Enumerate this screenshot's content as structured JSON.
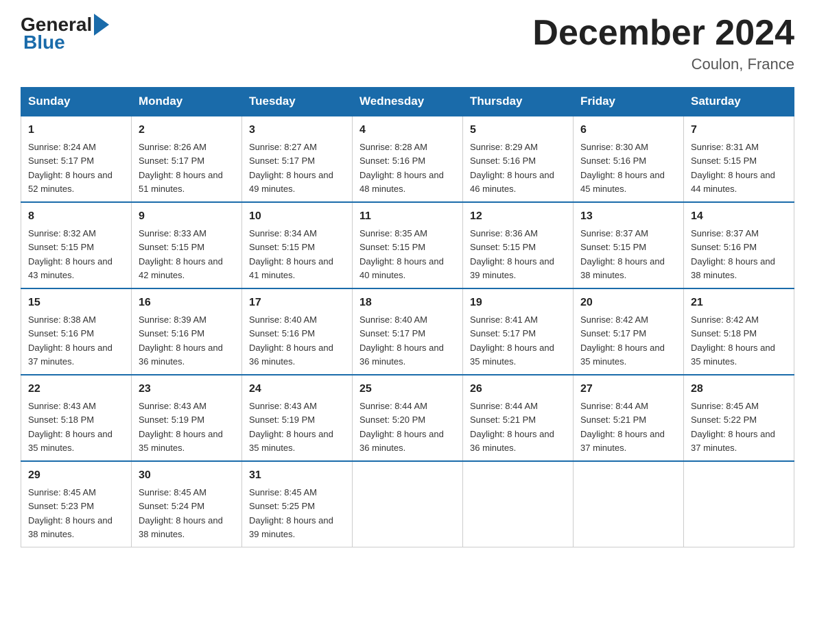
{
  "header": {
    "logo_general": "General",
    "logo_blue": "Blue",
    "title": "December 2024",
    "location": "Coulon, France"
  },
  "days_of_week": [
    "Sunday",
    "Monday",
    "Tuesday",
    "Wednesday",
    "Thursday",
    "Friday",
    "Saturday"
  ],
  "weeks": [
    [
      {
        "day": "1",
        "sunrise": "8:24 AM",
        "sunset": "5:17 PM",
        "daylight": "8 hours and 52 minutes."
      },
      {
        "day": "2",
        "sunrise": "8:26 AM",
        "sunset": "5:17 PM",
        "daylight": "8 hours and 51 minutes."
      },
      {
        "day": "3",
        "sunrise": "8:27 AM",
        "sunset": "5:17 PM",
        "daylight": "8 hours and 49 minutes."
      },
      {
        "day": "4",
        "sunrise": "8:28 AM",
        "sunset": "5:16 PM",
        "daylight": "8 hours and 48 minutes."
      },
      {
        "day": "5",
        "sunrise": "8:29 AM",
        "sunset": "5:16 PM",
        "daylight": "8 hours and 46 minutes."
      },
      {
        "day": "6",
        "sunrise": "8:30 AM",
        "sunset": "5:16 PM",
        "daylight": "8 hours and 45 minutes."
      },
      {
        "day": "7",
        "sunrise": "8:31 AM",
        "sunset": "5:15 PM",
        "daylight": "8 hours and 44 minutes."
      }
    ],
    [
      {
        "day": "8",
        "sunrise": "8:32 AM",
        "sunset": "5:15 PM",
        "daylight": "8 hours and 43 minutes."
      },
      {
        "day": "9",
        "sunrise": "8:33 AM",
        "sunset": "5:15 PM",
        "daylight": "8 hours and 42 minutes."
      },
      {
        "day": "10",
        "sunrise": "8:34 AM",
        "sunset": "5:15 PM",
        "daylight": "8 hours and 41 minutes."
      },
      {
        "day": "11",
        "sunrise": "8:35 AM",
        "sunset": "5:15 PM",
        "daylight": "8 hours and 40 minutes."
      },
      {
        "day": "12",
        "sunrise": "8:36 AM",
        "sunset": "5:15 PM",
        "daylight": "8 hours and 39 minutes."
      },
      {
        "day": "13",
        "sunrise": "8:37 AM",
        "sunset": "5:15 PM",
        "daylight": "8 hours and 38 minutes."
      },
      {
        "day": "14",
        "sunrise": "8:37 AM",
        "sunset": "5:16 PM",
        "daylight": "8 hours and 38 minutes."
      }
    ],
    [
      {
        "day": "15",
        "sunrise": "8:38 AM",
        "sunset": "5:16 PM",
        "daylight": "8 hours and 37 minutes."
      },
      {
        "day": "16",
        "sunrise": "8:39 AM",
        "sunset": "5:16 PM",
        "daylight": "8 hours and 36 minutes."
      },
      {
        "day": "17",
        "sunrise": "8:40 AM",
        "sunset": "5:16 PM",
        "daylight": "8 hours and 36 minutes."
      },
      {
        "day": "18",
        "sunrise": "8:40 AM",
        "sunset": "5:17 PM",
        "daylight": "8 hours and 36 minutes."
      },
      {
        "day": "19",
        "sunrise": "8:41 AM",
        "sunset": "5:17 PM",
        "daylight": "8 hours and 35 minutes."
      },
      {
        "day": "20",
        "sunrise": "8:42 AM",
        "sunset": "5:17 PM",
        "daylight": "8 hours and 35 minutes."
      },
      {
        "day": "21",
        "sunrise": "8:42 AM",
        "sunset": "5:18 PM",
        "daylight": "8 hours and 35 minutes."
      }
    ],
    [
      {
        "day": "22",
        "sunrise": "8:43 AM",
        "sunset": "5:18 PM",
        "daylight": "8 hours and 35 minutes."
      },
      {
        "day": "23",
        "sunrise": "8:43 AM",
        "sunset": "5:19 PM",
        "daylight": "8 hours and 35 minutes."
      },
      {
        "day": "24",
        "sunrise": "8:43 AM",
        "sunset": "5:19 PM",
        "daylight": "8 hours and 35 minutes."
      },
      {
        "day": "25",
        "sunrise": "8:44 AM",
        "sunset": "5:20 PM",
        "daylight": "8 hours and 36 minutes."
      },
      {
        "day": "26",
        "sunrise": "8:44 AM",
        "sunset": "5:21 PM",
        "daylight": "8 hours and 36 minutes."
      },
      {
        "day": "27",
        "sunrise": "8:44 AM",
        "sunset": "5:21 PM",
        "daylight": "8 hours and 37 minutes."
      },
      {
        "day": "28",
        "sunrise": "8:45 AM",
        "sunset": "5:22 PM",
        "daylight": "8 hours and 37 minutes."
      }
    ],
    [
      {
        "day": "29",
        "sunrise": "8:45 AM",
        "sunset": "5:23 PM",
        "daylight": "8 hours and 38 minutes."
      },
      {
        "day": "30",
        "sunrise": "8:45 AM",
        "sunset": "5:24 PM",
        "daylight": "8 hours and 38 minutes."
      },
      {
        "day": "31",
        "sunrise": "8:45 AM",
        "sunset": "5:25 PM",
        "daylight": "8 hours and 39 minutes."
      },
      null,
      null,
      null,
      null
    ]
  ],
  "labels": {
    "sunrise": "Sunrise:",
    "sunset": "Sunset:",
    "daylight": "Daylight:"
  }
}
